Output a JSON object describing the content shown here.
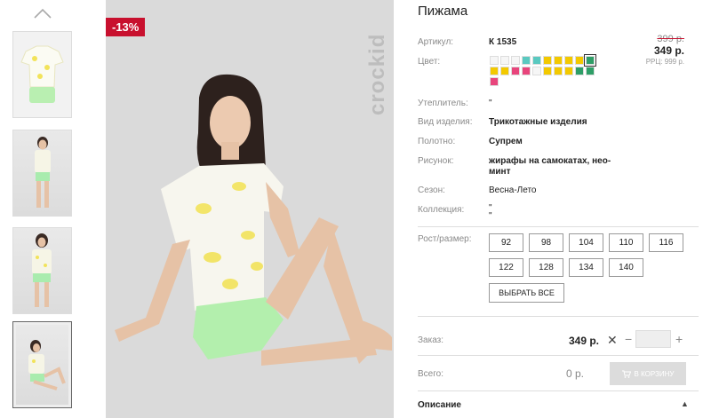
{
  "gallery": {
    "up_icon": "chevron-up-icon",
    "thumbnails": [
      "thumb-1",
      "thumb-2",
      "thumb-3",
      "thumb-4"
    ]
  },
  "main_image": {
    "discount_badge": "-13%",
    "brand_watermark": "crockid"
  },
  "product": {
    "title": "Пижама",
    "article_label": "Артикул:",
    "article_value": "К 1535",
    "color_label": "Цвет:",
    "price_old": "399 р.",
    "price_new": "349 р.",
    "rrp": "РРЦ: 999 р.",
    "colors": [
      "#f6f6f6",
      "#f6f6f6",
      "#f6f6f6",
      "#5ac9c0",
      "#5ac9c0",
      "#f3c900",
      "#f3c900",
      "#f3c900",
      "#f3c900",
      "#2e9e67",
      "#f3c900",
      "#f3c900",
      "#e8457c",
      "#e8457c",
      "#f6f6f6",
      "#f3c900",
      "#f3c900",
      "#f3c900",
      "#2e9e67",
      "#2e9e67",
      "#e8457c"
    ],
    "selected_color_index": 9,
    "specs": [
      {
        "label": "Утеплитель:",
        "value": "\"",
        "bold": false
      },
      {
        "label": "Вид изделия:",
        "value": "Трикотажные изделия",
        "bold": true
      },
      {
        "label": "Полотно:",
        "value": "Супрем",
        "bold": true
      },
      {
        "label": "Рисунок:",
        "value": "жирафы на самокатах, нео-",
        "value2": "минт",
        "bold": true
      },
      {
        "label": "Сезон:",
        "value": "Весна-Лето",
        "bold": false
      },
      {
        "label": "Коллекция:",
        "value": "\"",
        "value2": "\"",
        "bold": false
      }
    ],
    "size_label": "Рост/размер:",
    "sizes": [
      "92",
      "98",
      "104",
      "110",
      "116",
      "122",
      "128",
      "134",
      "140"
    ],
    "select_all": "ВЫБРАТЬ ВСЕ"
  },
  "order": {
    "label": "Заказ:",
    "price": "349 р.",
    "remove_symbol": "✕",
    "minus": "−",
    "plus": "+",
    "quantity": ""
  },
  "total": {
    "label": "Всего:",
    "value": "0 р.",
    "cart_button": "В КОРЗИНУ"
  },
  "description": {
    "label": "Описание",
    "chevron": "▲"
  }
}
